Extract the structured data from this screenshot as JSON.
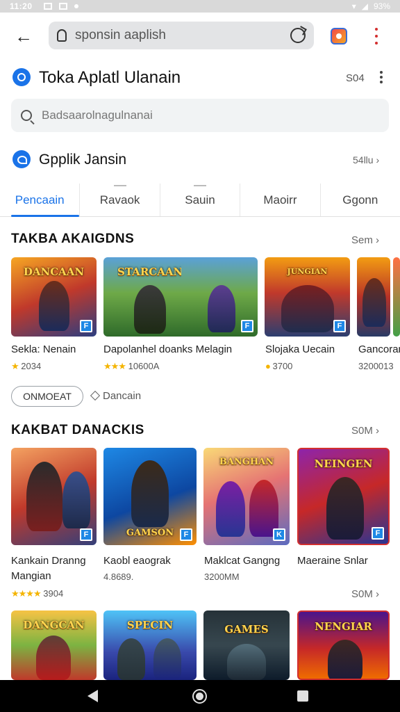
{
  "status_bar": {
    "time": "11:20",
    "battery": "93%"
  },
  "toolbar": {
    "url": "sponsin aaplish"
  },
  "header": {
    "title": "Toka Aplatl Ulanain",
    "link": "S04"
  },
  "search": {
    "placeholder": "Badsaarolnagulnanai"
  },
  "subheader": {
    "title": "Gpplik Jansin",
    "link": "54llu ›"
  },
  "tabs": [
    {
      "label": "Pencaain"
    },
    {
      "label": "Ravaok"
    },
    {
      "label": "Sauin"
    },
    {
      "label": "Maoirr"
    },
    {
      "label": "Ggonn"
    }
  ],
  "section1": {
    "title": "TAKBA AKAIGDNS",
    "see_all": "Sem ›",
    "items": [
      {
        "name": "Sekla: Nenain",
        "meta": "2034",
        "rating": "★",
        "logo": "DANCAAN"
      },
      {
        "name": "Dapolanhel doanks Melagin",
        "meta": "10600A",
        "rating": "★★★",
        "logo": "STARCAAN"
      },
      {
        "name": "Slojaka Uecain",
        "meta": "3700",
        "rating": "●",
        "logo": "JUNGIAN"
      },
      {
        "name": "Gancoran",
        "meta": "3200013",
        "rating": "",
        "logo": ""
      }
    ]
  },
  "chips": {
    "chip_label": "ONMOEAT",
    "chip_link": "Dancain"
  },
  "section2": {
    "title": "KAKBAT DANACKIS",
    "see_all": "S0M ›",
    "items": [
      {
        "name": "Kankain Dranng",
        "name2": "Mangian",
        "meta": "3904",
        "rating": "★★★★",
        "logo": ""
      },
      {
        "name": "Kaobl eaograk",
        "name2": "",
        "meta": "4.8689.",
        "rating": "",
        "logo": "GAMSON"
      },
      {
        "name": "Maklcat Gangng",
        "name2": "",
        "meta": "3200MM",
        "rating": "",
        "logo": "BANGHAN"
      },
      {
        "name": "Maeraine Snlar",
        "name2": "",
        "meta": "",
        "rating": "",
        "logo": "NEINGEN"
      }
    ],
    "more_link": "S0M ›"
  },
  "section3": {
    "items": [
      {
        "logo": "DANGCAN"
      },
      {
        "logo": "SPECIN"
      },
      {
        "logo": "GAMES"
      },
      {
        "logo": "NENGIAR"
      }
    ]
  },
  "colors": {
    "accent": "#1a73e8",
    "star": "#f4b400"
  }
}
